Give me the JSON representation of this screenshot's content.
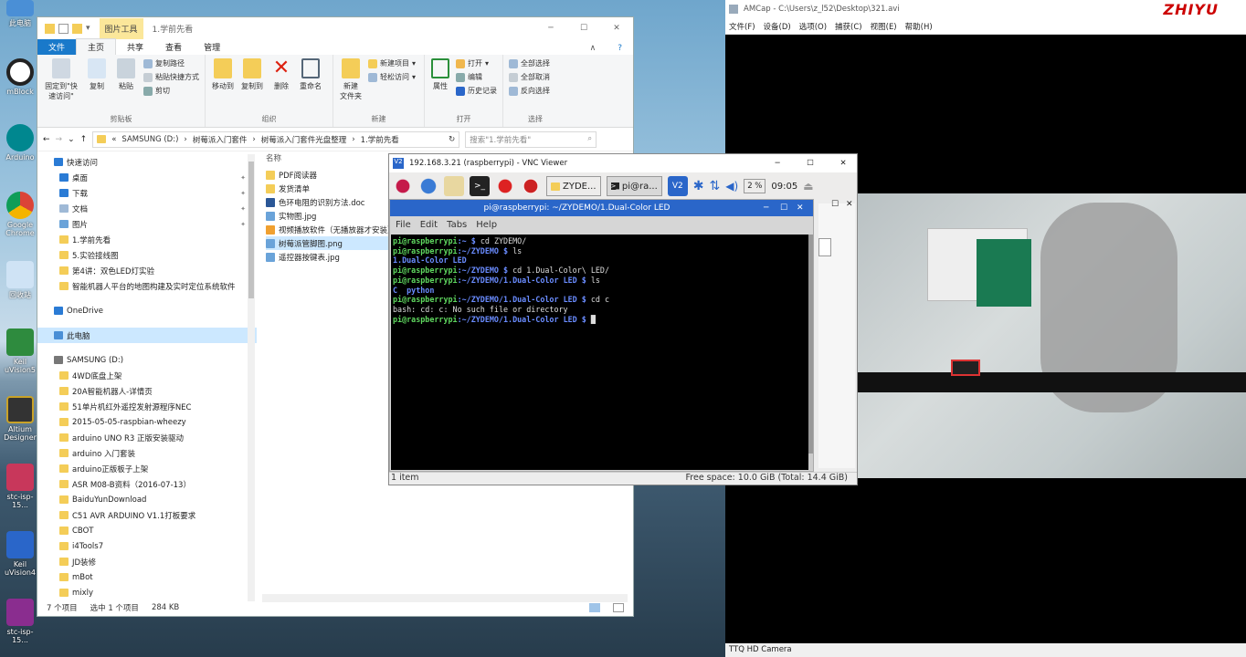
{
  "desktop": {
    "icons": [
      "此电脑",
      "mBlock",
      "Arduino",
      "Google Chrome",
      "回收站",
      "Keil uVision5",
      "Altium Designer",
      "stc-isp-15...",
      "Keil uVision4",
      "stc-isp-15..."
    ]
  },
  "explorer": {
    "title": "1.学前先看",
    "ribbon_context": "图片工具",
    "tabs": [
      "文件",
      "主页",
      "共享",
      "查看",
      "管理"
    ],
    "ribbon": {
      "pin": "固定到\"快速访问\"",
      "copy": "复制",
      "paste": "粘贴",
      "copy_path": "复制路径",
      "paste_shortcut": "粘贴快捷方式",
      "cut": "剪切",
      "clipboard": "剪贴板",
      "move_to": "移动到",
      "copy_to": "复制到",
      "delete": "删除",
      "rename": "重命名",
      "organize": "组织",
      "new_folder": "新建\n文件夹",
      "new_item": "新建项目",
      "easy_access": "轻松访问",
      "new": "新建",
      "properties": "属性",
      "open": "打开",
      "edit": "编辑",
      "history": "历史记录",
      "open_group": "打开",
      "select_all": "全部选择",
      "select_none": "全部取消",
      "invert": "反向选择",
      "select": "选择"
    },
    "address": [
      "«",
      "SAMSUNG (D:)",
      "›",
      "树莓派入门套件",
      "›",
      "树莓派入门套件光盘整理",
      "›",
      "1.学前先看"
    ],
    "search_placeholder": "搜索\"1.学前先看\"",
    "nav": [
      {
        "label": "快速访问",
        "type": "star",
        "indent": 0
      },
      {
        "label": "桌面",
        "type": "blue",
        "indent": 1,
        "pin": true
      },
      {
        "label": "下载",
        "type": "down",
        "indent": 1,
        "pin": true
      },
      {
        "label": "文档",
        "type": "doc",
        "indent": 1,
        "pin": true
      },
      {
        "label": "图片",
        "type": "pic",
        "indent": 1,
        "pin": true
      },
      {
        "label": "1.学前先看",
        "type": "folder",
        "indent": 1
      },
      {
        "label": "5.实验接线图",
        "type": "folder",
        "indent": 1
      },
      {
        "label": "第4讲：双色LED灯实验",
        "type": "folder",
        "indent": 1
      },
      {
        "label": "智能机器人平台的地图构建及实时定位系统软件",
        "type": "folder",
        "indent": 1
      },
      {
        "label": "",
        "type": "gap",
        "indent": 0
      },
      {
        "label": "OneDrive",
        "type": "cloud",
        "indent": 0
      },
      {
        "label": "",
        "type": "gap",
        "indent": 0
      },
      {
        "label": "此电脑",
        "type": "pc",
        "indent": 0,
        "selected": true
      },
      {
        "label": "",
        "type": "gap",
        "indent": 0
      },
      {
        "label": "SAMSUNG (D:)",
        "type": "drive",
        "indent": 0
      },
      {
        "label": "4WD底盘上架",
        "type": "folder",
        "indent": 1
      },
      {
        "label": "20A智能机器人-详情页",
        "type": "folder",
        "indent": 1
      },
      {
        "label": "51单片机红外遥控发射源程序NEC",
        "type": "folder",
        "indent": 1
      },
      {
        "label": "2015-05-05-raspbian-wheezy",
        "type": "folder",
        "indent": 1
      },
      {
        "label": "arduino UNO R3 正版安装驱动",
        "type": "folder",
        "indent": 1
      },
      {
        "label": "arduino 入门套装",
        "type": "folder",
        "indent": 1
      },
      {
        "label": "arduino正版板子上架",
        "type": "folder",
        "indent": 1
      },
      {
        "label": "ASR M08-B资料（2016-07-13）",
        "type": "folder",
        "indent": 1
      },
      {
        "label": "BaiduYunDownload",
        "type": "folder",
        "indent": 1
      },
      {
        "label": "C51 AVR ARDUINO V1.1打板要求",
        "type": "folder",
        "indent": 1
      },
      {
        "label": "CBOT",
        "type": "folder",
        "indent": 1
      },
      {
        "label": "i4Tools7",
        "type": "folder",
        "indent": 1
      },
      {
        "label": "JD装修",
        "type": "folder",
        "indent": 1
      },
      {
        "label": "mBot",
        "type": "folder",
        "indent": 1
      },
      {
        "label": "mixly",
        "type": "folder",
        "indent": 1
      }
    ],
    "col_name": "名称",
    "files": [
      {
        "name": "PDF阅读器",
        "type": "folder"
      },
      {
        "name": "发货清单",
        "type": "folder"
      },
      {
        "name": "色环电阻的识别方法.doc",
        "type": "doc"
      },
      {
        "name": "实物图.jpg",
        "type": "img"
      },
      {
        "name": "视频播放软件（无播放器才安装）",
        "type": "app"
      },
      {
        "name": "树莓派管脚图.png",
        "type": "img",
        "selected": true
      },
      {
        "name": "遥控器按键表.jpg",
        "type": "img"
      }
    ],
    "status_count": "7 个项目",
    "status_sel": "选中 1 个项目",
    "status_size": "284 KB"
  },
  "amcap": {
    "title": "AMCap - C:\\Users\\z_l52\\Desktop\\321.avi",
    "menu": [
      "文件(F)",
      "设备(D)",
      "选项(O)",
      "捕获(C)",
      "视图(E)",
      "帮助(H)"
    ],
    "status": "TTQ HD Camera",
    "logo": "ZHIYU"
  },
  "vnc": {
    "title": "192.168.3.21 (raspberrypi) - VNC Viewer",
    "taskbar": {
      "task1": "ZYDE...",
      "task2": "pi@ra...",
      "cpu": "2 %",
      "time": "09:05"
    },
    "terminal": {
      "title": "pi@raspberrypi: ~/ZYDEMO/1.Dual-Color LED",
      "menu": [
        "File",
        "Edit",
        "Tabs",
        "Help"
      ],
      "lines": [
        [
          {
            "t": "pi@raspberrypi",
            "c": "g"
          },
          {
            "t": ":~ $ ",
            "c": "b"
          },
          {
            "t": "cd ZYDEMO/",
            "c": "w"
          }
        ],
        [
          {
            "t": "pi@raspberrypi",
            "c": "g"
          },
          {
            "t": ":~/ZYDEMO $ ",
            "c": "b"
          },
          {
            "t": "ls",
            "c": "w"
          }
        ],
        [
          {
            "t": "1.Dual-Color LED",
            "c": "b"
          }
        ],
        [
          {
            "t": "pi@raspberrypi",
            "c": "g"
          },
          {
            "t": ":~/ZYDEMO $ ",
            "c": "b"
          },
          {
            "t": "cd 1.Dual-Color\\ LED/",
            "c": "w"
          }
        ],
        [
          {
            "t": "pi@raspberrypi",
            "c": "g"
          },
          {
            "t": ":~/ZYDEMO/1.Dual-Color LED $ ",
            "c": "b"
          },
          {
            "t": "ls",
            "c": "w"
          }
        ],
        [
          {
            "t": "C  python",
            "c": "b"
          }
        ],
        [
          {
            "t": "pi@raspberrypi",
            "c": "g"
          },
          {
            "t": ":~/ZYDEMO/1.Dual-Color LED $ ",
            "c": "b"
          },
          {
            "t": "cd c",
            "c": "w"
          }
        ],
        [
          {
            "t": "bash: cd: c: No such file or directory",
            "c": "w"
          }
        ],
        [
          {
            "t": "pi@raspberrypi",
            "c": "g"
          },
          {
            "t": ":~/ZYDEMO/1.Dual-Color LED $ ",
            "c": "b"
          },
          {
            "t": "█",
            "c": "w"
          }
        ]
      ]
    },
    "fm_status_left": "1 item",
    "fm_status_right": "Free space: 10.0 GiB (Total: 14.4 GiB)"
  }
}
